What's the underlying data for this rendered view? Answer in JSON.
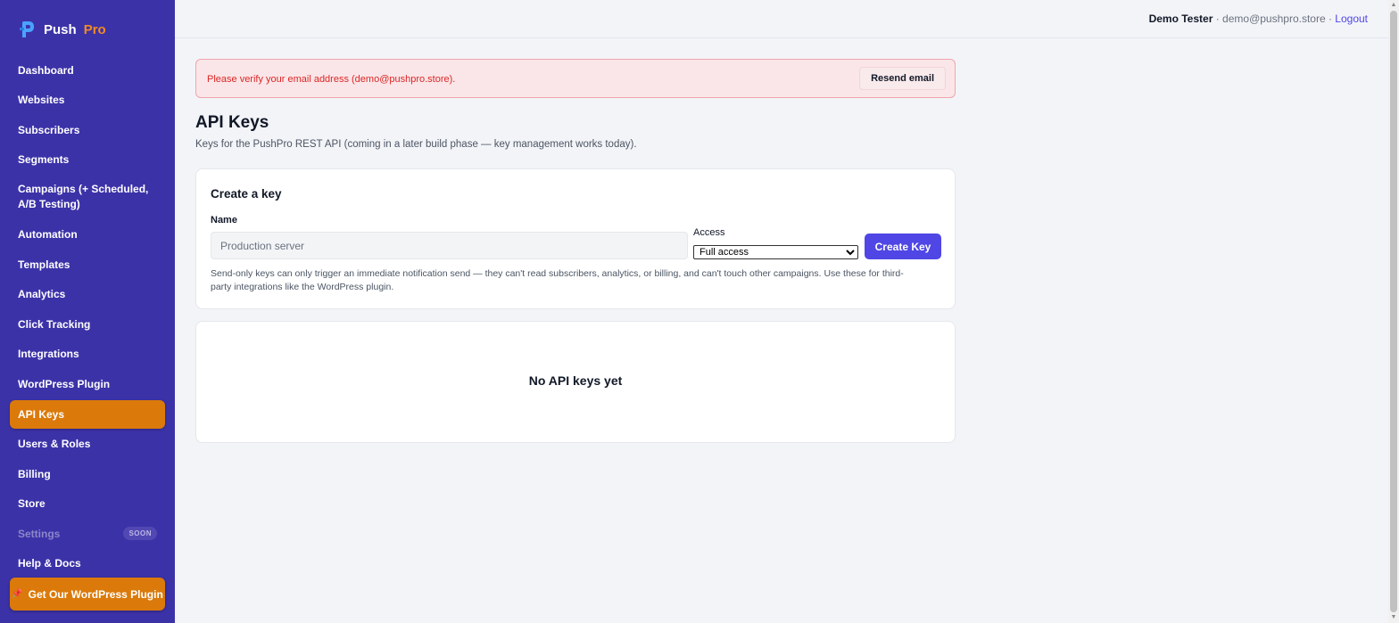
{
  "brand": {
    "name": "Push",
    "accent": "Pro",
    "accent_color": "#f08a24",
    "sidebar_color": "#3c32a8"
  },
  "sidebar": {
    "items": [
      {
        "label": "Dashboard"
      },
      {
        "label": "Websites"
      },
      {
        "label": "Subscribers"
      },
      {
        "label": "Segments"
      },
      {
        "label": "Campaigns (+ Scheduled, A/B Testing)"
      },
      {
        "label": "Automation"
      },
      {
        "label": "Templates"
      },
      {
        "label": "Analytics"
      },
      {
        "label": "Click Tracking"
      },
      {
        "label": "Integrations"
      },
      {
        "label": "WordPress Plugin"
      },
      {
        "label": "API Keys",
        "active": true
      },
      {
        "label": "Users & Roles"
      },
      {
        "label": "Billing"
      },
      {
        "label": "Store"
      },
      {
        "label": "Settings",
        "badge": "SOON",
        "disabled": true
      },
      {
        "label": "Help & Docs"
      }
    ],
    "cta_label": "Get Our WordPress Plugin",
    "cta_icon": "pin-icon"
  },
  "topbar": {
    "user_name": "Demo Tester",
    "separator": " · ",
    "user_email": "demo@pushpro.store",
    "logout_label": "Logout"
  },
  "alert": {
    "message": "Please verify your email address (demo@pushpro.store).",
    "button_label": "Resend email"
  },
  "page": {
    "title": "API Keys",
    "subtitle": "Keys for the PushPro REST API (coming in a later build phase — key management works today)."
  },
  "create_form": {
    "title": "Create a key",
    "name_label": "Name",
    "name_placeholder": "Production server",
    "access_label": "Access",
    "access_selected": "Full access",
    "submit_label": "Create Key",
    "help_text": "Send-only keys can only trigger an immediate notification send — they can't read subscribers, analytics, or billing, and can't touch other campaigns. Use these for third-party integrations like the WordPress plugin."
  },
  "keys_list": {
    "empty_message": "No API keys yet"
  }
}
